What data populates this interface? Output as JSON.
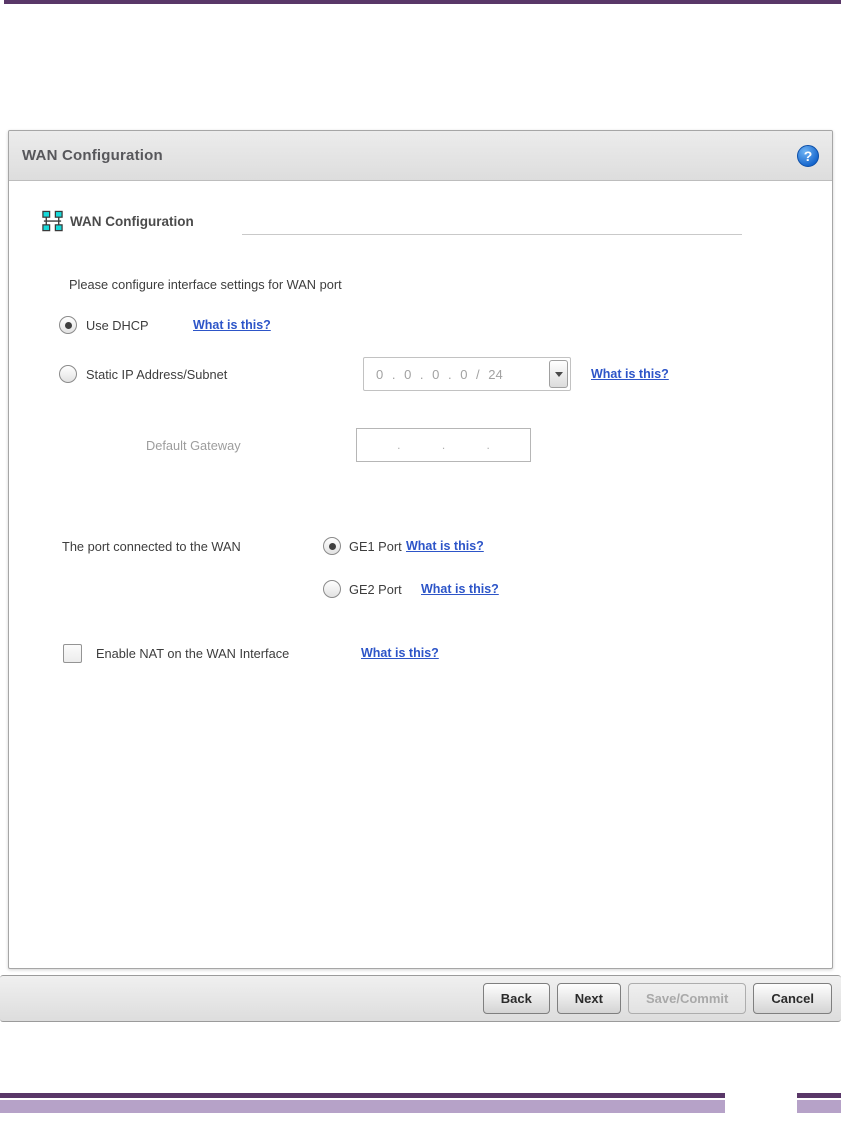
{
  "colors": {
    "accent_dark_purple": "#593768",
    "accent_light_purple": "#b6a2c8",
    "link_blue": "#2d55c8",
    "help_icon_blue": "#1565cc"
  },
  "dialog": {
    "title": "WAN Configuration",
    "help_glyph": "?",
    "section_title": "WAN Configuration",
    "instruction": "Please configure interface settings for WAN port",
    "dhcp": {
      "label": "Use DHCP",
      "selected": true,
      "help": "What is this?"
    },
    "static_ip": {
      "label": "Static IP Address/Subnet",
      "selected": false,
      "value": "0 . 0 . 0 . 0 / 24",
      "help": "What is this?"
    },
    "gateway": {
      "label": "Default Gateway",
      "empty_value": ". . ."
    },
    "wan_port": {
      "label": "The port connected to the WAN",
      "options": [
        {
          "label": "GE1 Port",
          "selected": true,
          "help": "What is this?"
        },
        {
          "label": "GE2 Port",
          "selected": false,
          "help": "What is this?"
        }
      ]
    },
    "nat": {
      "label": "Enable NAT on the WAN Interface",
      "checked": false,
      "help": "What is this?"
    }
  },
  "footer": {
    "buttons": [
      {
        "label": "Back",
        "disabled": false
      },
      {
        "label": "Next",
        "disabled": false
      },
      {
        "label": "Save/Commit",
        "disabled": true
      },
      {
        "label": "Cancel",
        "disabled": false
      }
    ]
  }
}
